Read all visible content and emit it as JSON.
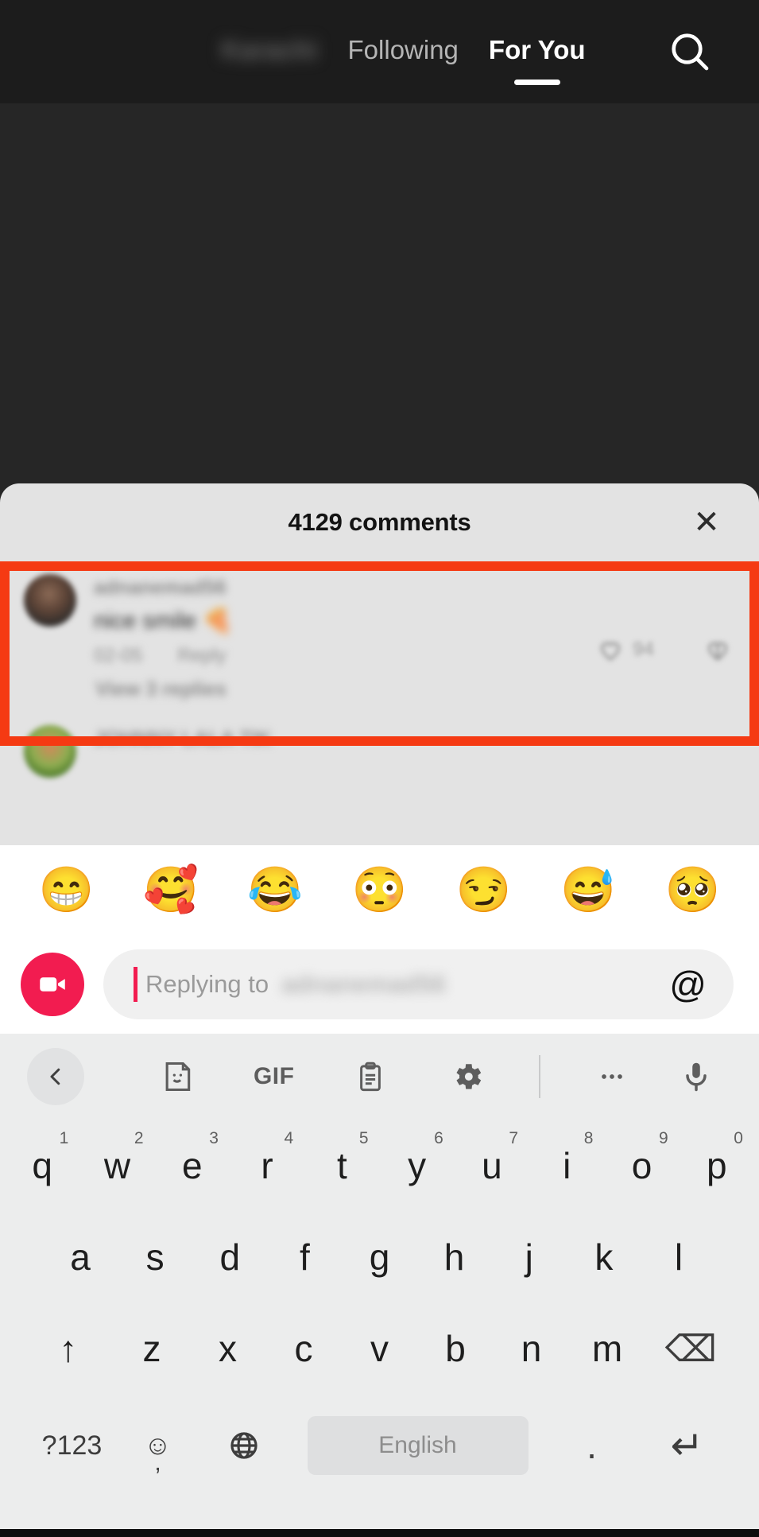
{
  "topnav": {
    "tabs": [
      {
        "label": "Karachi",
        "state": "blurred"
      },
      {
        "label": "Following",
        "state": "inactive"
      },
      {
        "label": "For You",
        "state": "active"
      }
    ],
    "search_icon": "search-icon"
  },
  "sheet": {
    "title": "4129 comments",
    "close_label": "✕",
    "comments": [
      {
        "username": "adnanemad56",
        "text": "nice smile",
        "emoji": "🍕",
        "timestamp": "02-05",
        "reply_label": "Reply",
        "like_count": "94",
        "avatar": "user-avatar-1",
        "highlighted": true
      },
      {
        "username": "JOHNNY LALA TIK",
        "text": "",
        "emoji": "",
        "timestamp": "",
        "reply_label": "",
        "like_count": "",
        "avatar": "user-avatar-2",
        "highlighted": false
      }
    ],
    "view_replies_label": "View 3 replies"
  },
  "emoji_bar": {
    "emojis": [
      {
        "name": "grinning-face-emoji",
        "glyph": "😁"
      },
      {
        "name": "smiling-face-with-hearts-emoji",
        "glyph": "🥰"
      },
      {
        "name": "face-with-tears-of-joy-emoji",
        "glyph": "😂"
      },
      {
        "name": "flushed-face-emoji",
        "glyph": "😳"
      },
      {
        "name": "smirking-face-emoji",
        "glyph": "😏"
      },
      {
        "name": "grinning-face-with-sweat-emoji",
        "glyph": "😅"
      },
      {
        "name": "pleading-face-emoji",
        "glyph": "🥺"
      }
    ]
  },
  "reply_bar": {
    "placeholder_prefix": "Replying to ",
    "placeholder_user": "adnanemad56",
    "at_label": "@",
    "video_button": "video-reply-icon"
  },
  "keyboard": {
    "toolbar": [
      {
        "name": "back-chevron-icon",
        "label": "‹"
      },
      {
        "name": "sticker-icon",
        "label": ""
      },
      {
        "name": "gif-icon",
        "label": "GIF"
      },
      {
        "name": "clipboard-icon",
        "label": ""
      },
      {
        "name": "settings-gear-icon",
        "label": ""
      },
      {
        "name": "toolbar-divider",
        "label": ""
      },
      {
        "name": "more-options-icon",
        "label": "•••"
      },
      {
        "name": "microphone-icon",
        "label": ""
      }
    ],
    "row1": [
      {
        "key": "q",
        "sup": "1"
      },
      {
        "key": "w",
        "sup": "2"
      },
      {
        "key": "e",
        "sup": "3"
      },
      {
        "key": "r",
        "sup": "4"
      },
      {
        "key": "t",
        "sup": "5"
      },
      {
        "key": "y",
        "sup": "6"
      },
      {
        "key": "u",
        "sup": "7"
      },
      {
        "key": "i",
        "sup": "8"
      },
      {
        "key": "o",
        "sup": "9"
      },
      {
        "key": "p",
        "sup": "0"
      }
    ],
    "row2": [
      "a",
      "s",
      "d",
      "f",
      "g",
      "h",
      "j",
      "k",
      "l"
    ],
    "row3": {
      "shift": "↑",
      "letters": [
        "z",
        "x",
        "c",
        "v",
        "b",
        "n",
        "m"
      ],
      "backspace": "⌫"
    },
    "row4": {
      "symbols": "?123",
      "emoji_key": "☺",
      "comma": ",",
      "globe": "globe-icon",
      "space_label": "English",
      "period": ".",
      "enter": "↵"
    }
  },
  "colors": {
    "accent_red": "#f21c50",
    "annotation": "#f53a13",
    "sheet_bg": "#e3e3e3",
    "keyboard_bg": "#eceded",
    "nav_bg": "#1c1c1c",
    "video_bg": "#262626"
  }
}
